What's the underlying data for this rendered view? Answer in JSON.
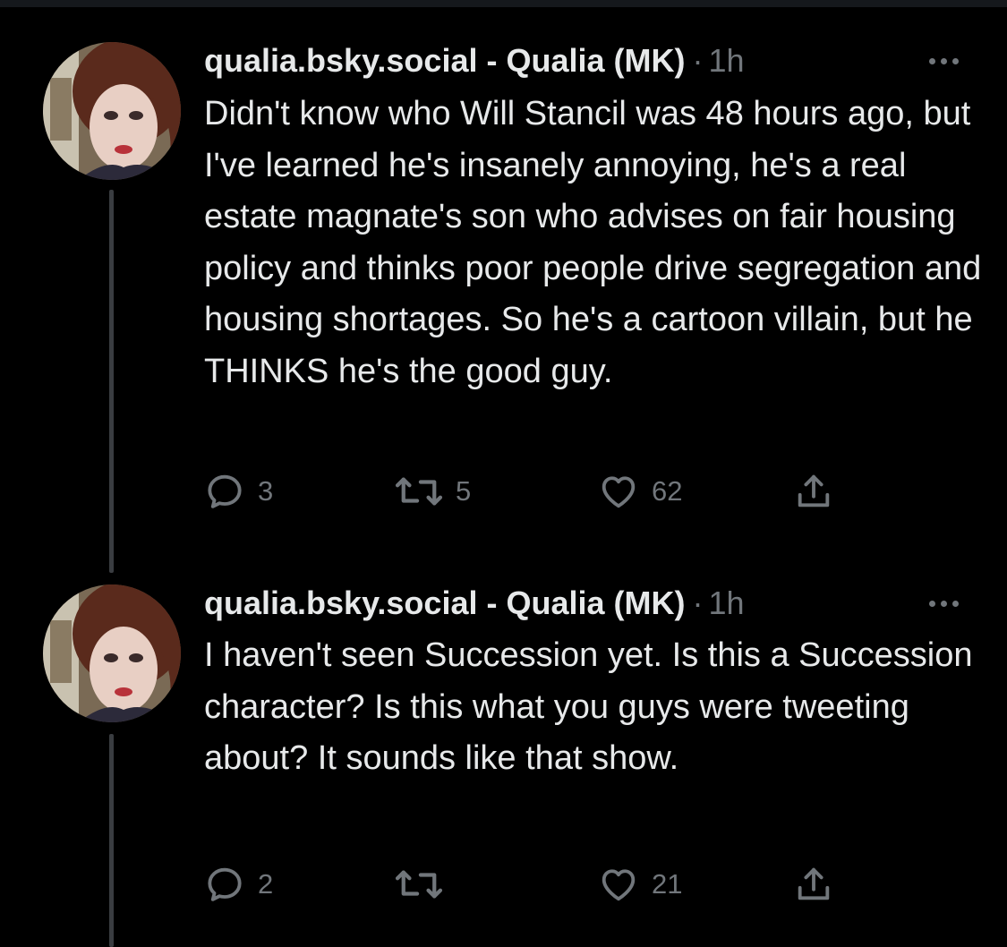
{
  "colors": {
    "background": "#000000",
    "text_primary": "#e7e9ea",
    "text_secondary": "#71767b",
    "thread_line": "#3a3d41"
  },
  "tweets": [
    {
      "author": "qualia.bsky.social - Qualia (MK)",
      "separator": "·",
      "time": "1h",
      "text": "Didn't know who Will Stancil was 48 hours ago, but I've learned he's insanely annoying, he's a real estate magnate's son who advises on fair housing policy and thinks poor people drive segregation and housing shortages. So he's a cartoon villain, but he THINKS he's the good guy.",
      "icons": {
        "reply": "reply-icon",
        "retweet": "retweet-icon",
        "like": "heart-icon",
        "share": "share-icon",
        "more": "more-icon"
      },
      "replies": "3",
      "retweets": "5",
      "likes": "62"
    },
    {
      "author": "qualia.bsky.social - Qualia (MK)",
      "separator": "·",
      "time": "1h",
      "text": "I haven't seen Succession yet. Is this a Succession character? Is this what you guys were tweeting about? It sounds like that show.",
      "icons": {
        "reply": "reply-icon",
        "retweet": "retweet-icon",
        "like": "heart-icon",
        "share": "share-icon",
        "more": "more-icon"
      },
      "replies": "2",
      "retweets": "",
      "likes": "21"
    }
  ]
}
